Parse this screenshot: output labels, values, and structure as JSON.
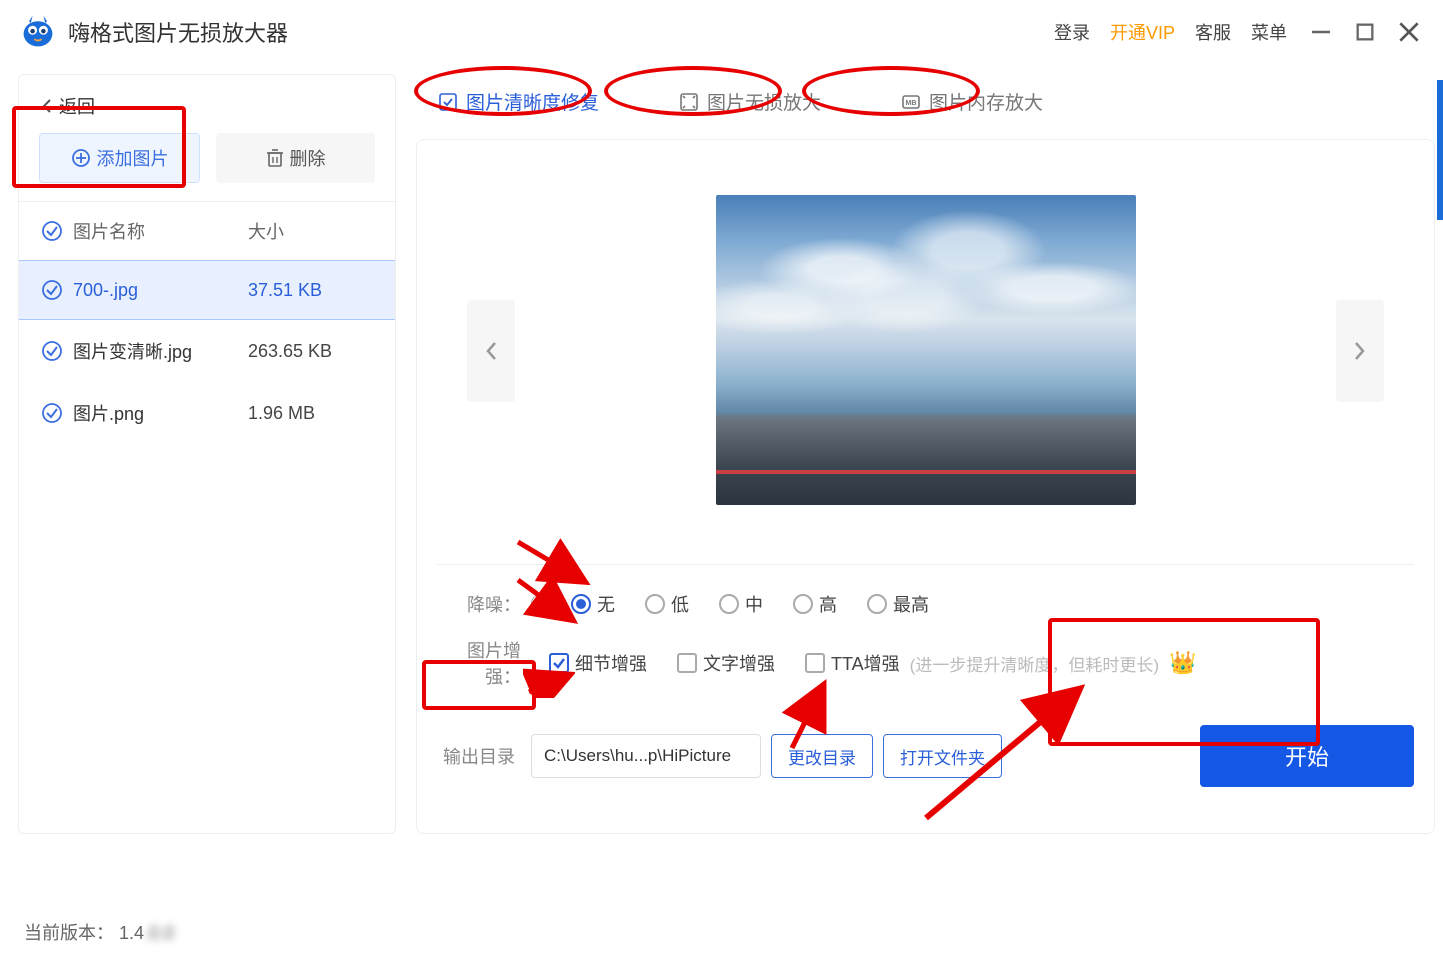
{
  "titlebar": {
    "app_title": "嗨格式图片无损放大器",
    "links": {
      "login": "登录",
      "vip": "开通VIP",
      "support": "客服",
      "menu": "菜单"
    }
  },
  "sidebar": {
    "back": "返回",
    "add_btn": "添加图片",
    "del_btn": "删除",
    "header": {
      "name": "图片名称",
      "size": "大小"
    },
    "files": [
      {
        "name": "700-.jpg",
        "size": "37.51 KB",
        "active": true
      },
      {
        "name": "图片变清晰.jpg",
        "size": "263.65 KB",
        "active": false
      },
      {
        "name": "图片.png",
        "size": "1.96 MB",
        "active": false
      }
    ]
  },
  "tabs": [
    {
      "label": "图片清晰度修复",
      "active": true
    },
    {
      "label": "图片无损放大",
      "active": false
    },
    {
      "label": "图片内存放大",
      "active": false
    }
  ],
  "noise": {
    "label": "降噪：",
    "options": [
      "无",
      "低",
      "中",
      "高",
      "最高"
    ],
    "selected": "无"
  },
  "enhance": {
    "label": "图片增强：",
    "options": [
      {
        "label": "细节增强",
        "checked": true
      },
      {
        "label": "文字增强",
        "checked": false
      },
      {
        "label": "TTA增强",
        "checked": false
      }
    ],
    "hint": "(进一步提升清晰度，但耗时更长)"
  },
  "output": {
    "label": "输出目录",
    "path": "C:\\Users\\hu...p\\HiPicture",
    "change_dir": "更改目录",
    "open_folder": "打开文件夹",
    "start": "开始"
  },
  "footer": {
    "version_label": "当前版本：",
    "version_prefix": "1.4",
    "version_blur": ".0.0"
  }
}
